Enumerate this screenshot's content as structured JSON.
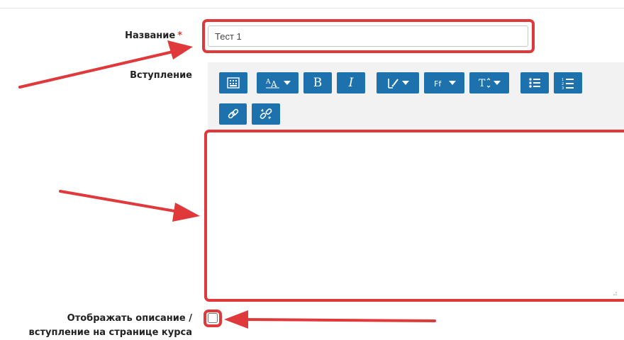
{
  "form": {
    "name_label": "Название",
    "required_mark": "*",
    "name_value": "Тест 1",
    "intro_label": "Вступление",
    "show_desc_label_line1": "Отображать описание /",
    "show_desc_label_line2": "вступление на странице курса",
    "show_desc_checked": false
  },
  "toolbar": {
    "row1": [
      "show-more-icon",
      "font-style-icon",
      "bold-icon",
      "italic-icon",
      "font-color-icon",
      "font-family-icon",
      "font-size-icon",
      "unordered-list-icon",
      "ordered-list-icon"
    ],
    "row2": [
      "link-icon",
      "unlink-icon"
    ],
    "bold_glyph": "B",
    "italic_glyph": "I"
  },
  "colors": {
    "highlight": "#e0393b",
    "toolbar_button": "#1d72ad",
    "required": "#e23b2e"
  }
}
